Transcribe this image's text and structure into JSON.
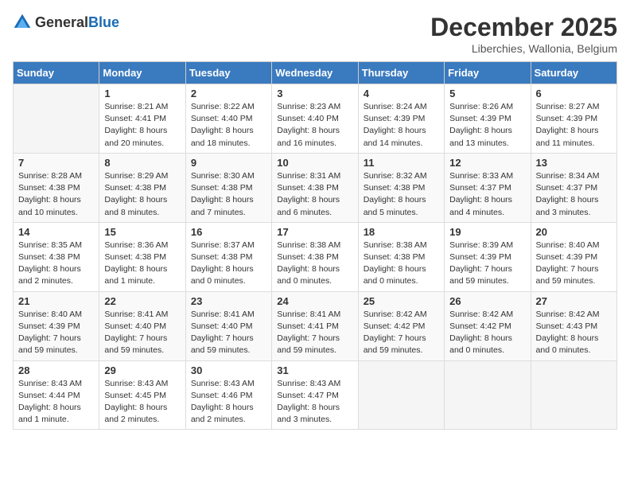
{
  "logo": {
    "general": "General",
    "blue": "Blue"
  },
  "header": {
    "month": "December 2025",
    "location": "Liberchies, Wallonia, Belgium"
  },
  "weekdays": [
    "Sunday",
    "Monday",
    "Tuesday",
    "Wednesday",
    "Thursday",
    "Friday",
    "Saturday"
  ],
  "weeks": [
    [
      {
        "day": "",
        "info": ""
      },
      {
        "day": "1",
        "info": "Sunrise: 8:21 AM\nSunset: 4:41 PM\nDaylight: 8 hours\nand 20 minutes."
      },
      {
        "day": "2",
        "info": "Sunrise: 8:22 AM\nSunset: 4:40 PM\nDaylight: 8 hours\nand 18 minutes."
      },
      {
        "day": "3",
        "info": "Sunrise: 8:23 AM\nSunset: 4:40 PM\nDaylight: 8 hours\nand 16 minutes."
      },
      {
        "day": "4",
        "info": "Sunrise: 8:24 AM\nSunset: 4:39 PM\nDaylight: 8 hours\nand 14 minutes."
      },
      {
        "day": "5",
        "info": "Sunrise: 8:26 AM\nSunset: 4:39 PM\nDaylight: 8 hours\nand 13 minutes."
      },
      {
        "day": "6",
        "info": "Sunrise: 8:27 AM\nSunset: 4:39 PM\nDaylight: 8 hours\nand 11 minutes."
      }
    ],
    [
      {
        "day": "7",
        "info": "Sunrise: 8:28 AM\nSunset: 4:38 PM\nDaylight: 8 hours\nand 10 minutes."
      },
      {
        "day": "8",
        "info": "Sunrise: 8:29 AM\nSunset: 4:38 PM\nDaylight: 8 hours\nand 8 minutes."
      },
      {
        "day": "9",
        "info": "Sunrise: 8:30 AM\nSunset: 4:38 PM\nDaylight: 8 hours\nand 7 minutes."
      },
      {
        "day": "10",
        "info": "Sunrise: 8:31 AM\nSunset: 4:38 PM\nDaylight: 8 hours\nand 6 minutes."
      },
      {
        "day": "11",
        "info": "Sunrise: 8:32 AM\nSunset: 4:38 PM\nDaylight: 8 hours\nand 5 minutes."
      },
      {
        "day": "12",
        "info": "Sunrise: 8:33 AM\nSunset: 4:37 PM\nDaylight: 8 hours\nand 4 minutes."
      },
      {
        "day": "13",
        "info": "Sunrise: 8:34 AM\nSunset: 4:37 PM\nDaylight: 8 hours\nand 3 minutes."
      }
    ],
    [
      {
        "day": "14",
        "info": "Sunrise: 8:35 AM\nSunset: 4:38 PM\nDaylight: 8 hours\nand 2 minutes."
      },
      {
        "day": "15",
        "info": "Sunrise: 8:36 AM\nSunset: 4:38 PM\nDaylight: 8 hours\nand 1 minute."
      },
      {
        "day": "16",
        "info": "Sunrise: 8:37 AM\nSunset: 4:38 PM\nDaylight: 8 hours\nand 0 minutes."
      },
      {
        "day": "17",
        "info": "Sunrise: 8:38 AM\nSunset: 4:38 PM\nDaylight: 8 hours\nand 0 minutes."
      },
      {
        "day": "18",
        "info": "Sunrise: 8:38 AM\nSunset: 4:38 PM\nDaylight: 8 hours\nand 0 minutes."
      },
      {
        "day": "19",
        "info": "Sunrise: 8:39 AM\nSunset: 4:39 PM\nDaylight: 7 hours\nand 59 minutes."
      },
      {
        "day": "20",
        "info": "Sunrise: 8:40 AM\nSunset: 4:39 PM\nDaylight: 7 hours\nand 59 minutes."
      }
    ],
    [
      {
        "day": "21",
        "info": "Sunrise: 8:40 AM\nSunset: 4:39 PM\nDaylight: 7 hours\nand 59 minutes."
      },
      {
        "day": "22",
        "info": "Sunrise: 8:41 AM\nSunset: 4:40 PM\nDaylight: 7 hours\nand 59 minutes."
      },
      {
        "day": "23",
        "info": "Sunrise: 8:41 AM\nSunset: 4:40 PM\nDaylight: 7 hours\nand 59 minutes."
      },
      {
        "day": "24",
        "info": "Sunrise: 8:41 AM\nSunset: 4:41 PM\nDaylight: 7 hours\nand 59 minutes."
      },
      {
        "day": "25",
        "info": "Sunrise: 8:42 AM\nSunset: 4:42 PM\nDaylight: 7 hours\nand 59 minutes."
      },
      {
        "day": "26",
        "info": "Sunrise: 8:42 AM\nSunset: 4:42 PM\nDaylight: 8 hours\nand 0 minutes."
      },
      {
        "day": "27",
        "info": "Sunrise: 8:42 AM\nSunset: 4:43 PM\nDaylight: 8 hours\nand 0 minutes."
      }
    ],
    [
      {
        "day": "28",
        "info": "Sunrise: 8:43 AM\nSunset: 4:44 PM\nDaylight: 8 hours\nand 1 minute."
      },
      {
        "day": "29",
        "info": "Sunrise: 8:43 AM\nSunset: 4:45 PM\nDaylight: 8 hours\nand 2 minutes."
      },
      {
        "day": "30",
        "info": "Sunrise: 8:43 AM\nSunset: 4:46 PM\nDaylight: 8 hours\nand 2 minutes."
      },
      {
        "day": "31",
        "info": "Sunrise: 8:43 AM\nSunset: 4:47 PM\nDaylight: 8 hours\nand 3 minutes."
      },
      {
        "day": "",
        "info": ""
      },
      {
        "day": "",
        "info": ""
      },
      {
        "day": "",
        "info": ""
      }
    ]
  ]
}
